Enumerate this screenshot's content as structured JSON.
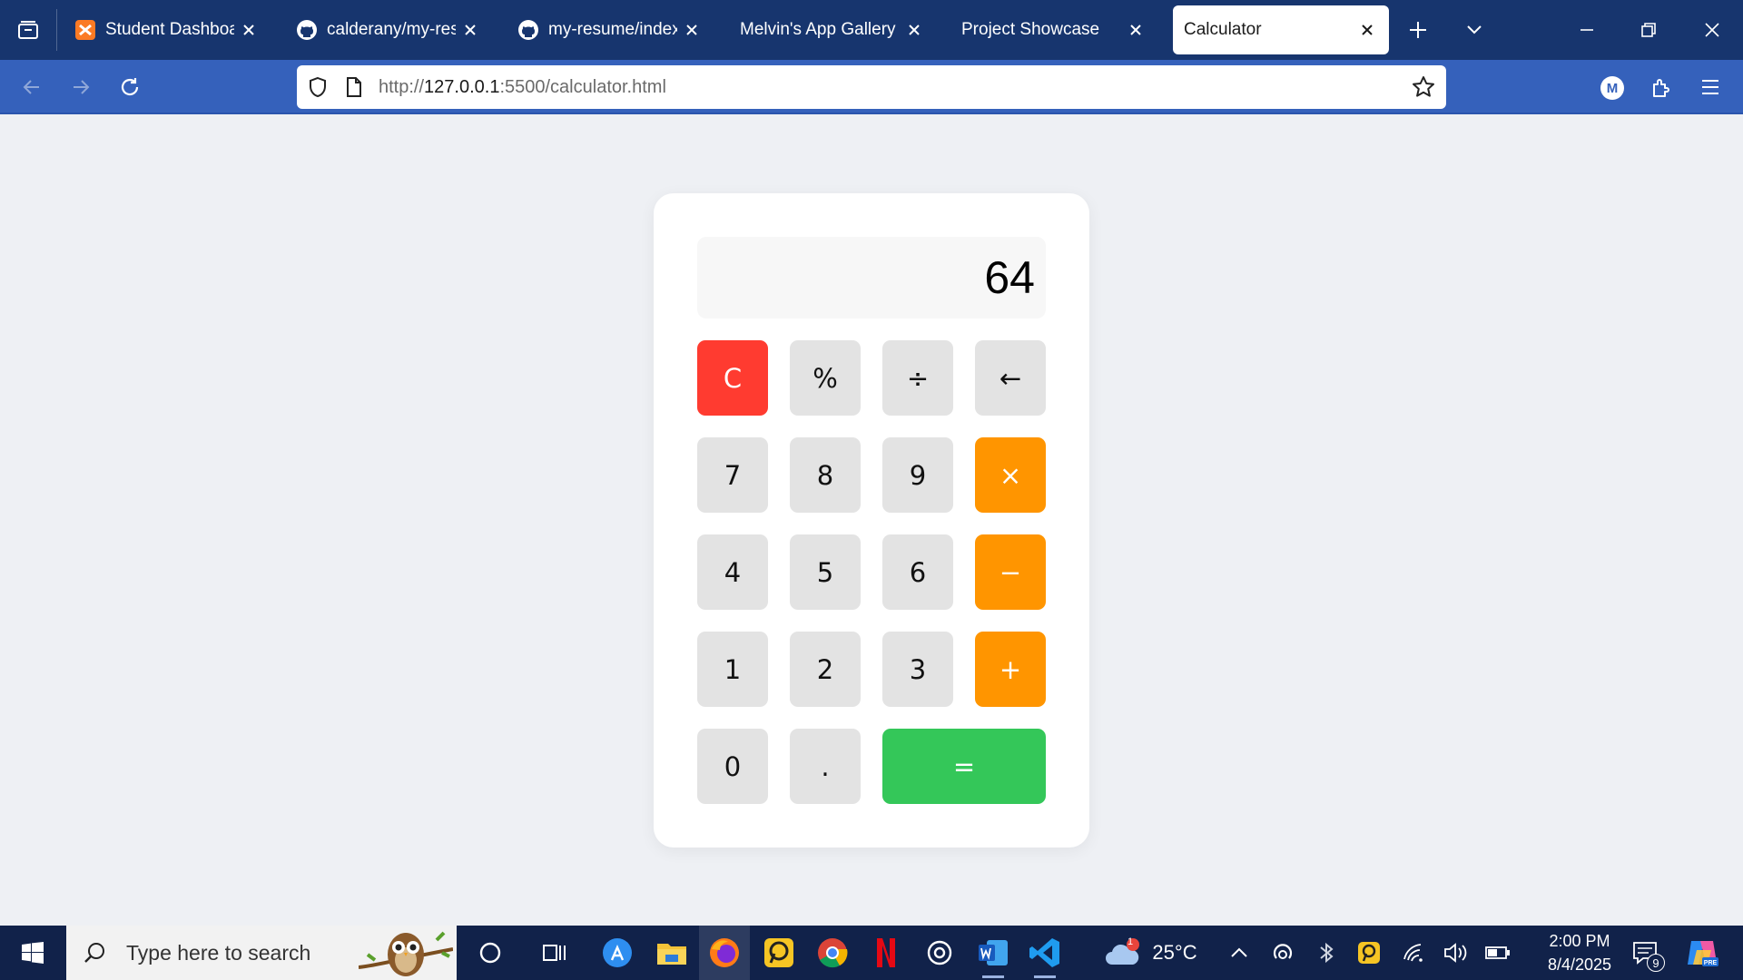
{
  "browser": {
    "tabs": [
      {
        "label": "Student Dashboard",
        "icon": "xampp-icon"
      },
      {
        "label": "calderany/my-resum",
        "icon": "github-icon"
      },
      {
        "label": "my-resume/index.ht",
        "icon": "github-icon"
      },
      {
        "label": "Melvin's App Gallery",
        "icon": ""
      },
      {
        "label": "Project Showcase",
        "icon": ""
      },
      {
        "label": "Calculator",
        "icon": "",
        "active": true
      }
    ],
    "url_prefix": "http://",
    "url_host": "127.0.0.1",
    "url_rest": ":5500/calculator.html",
    "profile_initial": "M",
    "accent": "#17356e",
    "toolbar_color": "#3561bb"
  },
  "calculator": {
    "display": "64",
    "keys": {
      "clear": "C",
      "percent": "%",
      "divide": "÷",
      "backspace": "←",
      "seven": "7",
      "eight": "8",
      "nine": "9",
      "multiply": "×",
      "four": "4",
      "five": "5",
      "six": "6",
      "minus": "−",
      "one": "1",
      "two": "2",
      "three": "3",
      "plus": "+",
      "zero": "0",
      "dot": ".",
      "equals": "="
    },
    "colors": {
      "clear": "#ff3b30",
      "operator": "#ff9500",
      "equals": "#34c759",
      "key": "#e3e3e3"
    }
  },
  "taskbar": {
    "search_placeholder": "Type here to search",
    "temperature": "25°C",
    "weather_badge": "1",
    "time": "2:00 PM",
    "date": "8/4/2025",
    "notification_count": "9",
    "apps": [
      "cortana-icon",
      "task-view-icon",
      "app-store-icon",
      "file-explorer-icon",
      "firefox-icon",
      "pdf-reader-icon",
      "chrome-icon",
      "netflix-icon",
      "chatgpt-icon",
      "word-icon",
      "vscode-icon"
    ]
  }
}
